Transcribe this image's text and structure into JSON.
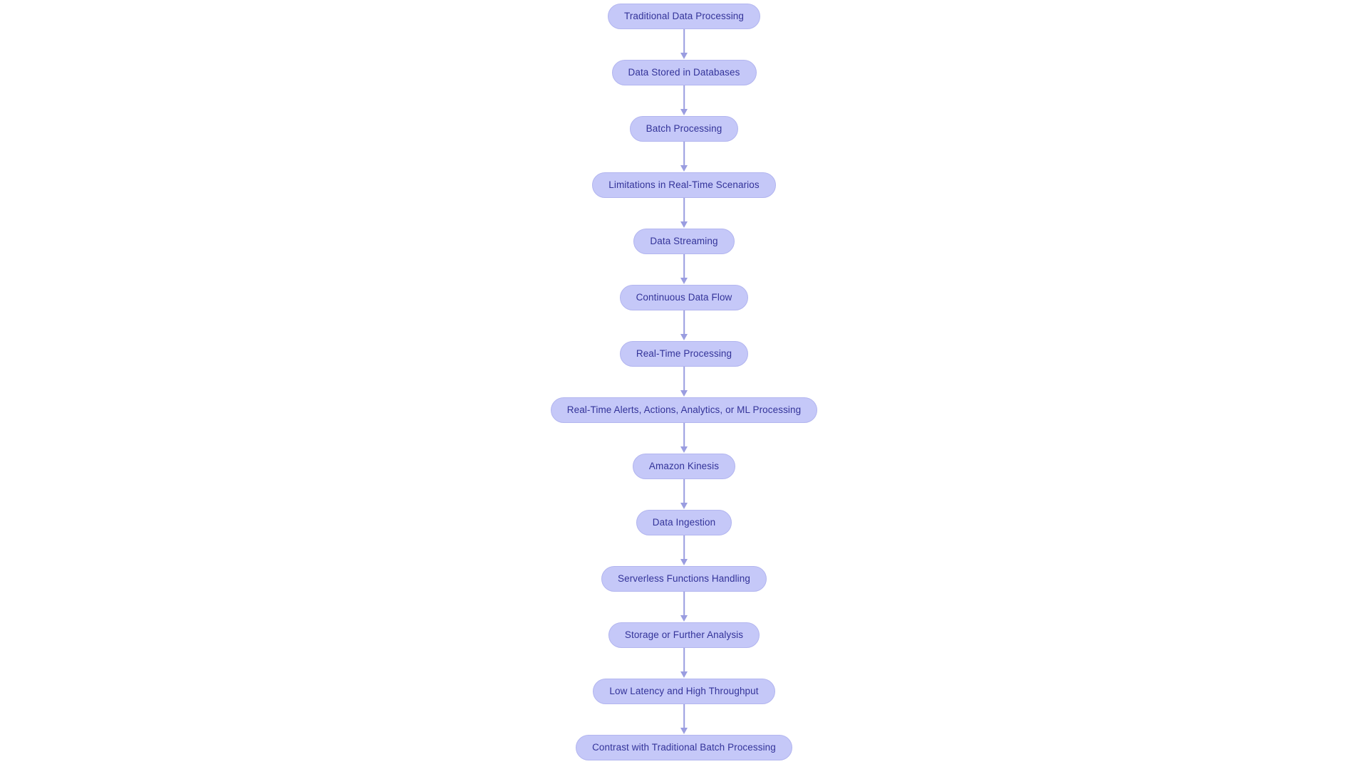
{
  "diagram": {
    "type": "flowchart",
    "orientation": "top-to-bottom",
    "title": "",
    "background_color": "#ffffff",
    "node_fill_color": "#c5c8f8",
    "node_border_color": "#b2b5ef",
    "node_text_color": "#333399",
    "connector_color": "#9a9de0",
    "nodes": [
      {
        "id": "n1",
        "label": "Traditional Data Processing"
      },
      {
        "id": "n2",
        "label": "Data Stored in Databases"
      },
      {
        "id": "n3",
        "label": "Batch Processing"
      },
      {
        "id": "n4",
        "label": "Limitations in Real-Time Scenarios"
      },
      {
        "id": "n5",
        "label": "Data Streaming"
      },
      {
        "id": "n6",
        "label": "Continuous Data Flow"
      },
      {
        "id": "n7",
        "label": "Real-Time Processing"
      },
      {
        "id": "n8",
        "label": "Real-Time Alerts, Actions, Analytics, or ML Processing"
      },
      {
        "id": "n9",
        "label": "Amazon Kinesis"
      },
      {
        "id": "n10",
        "label": "Data Ingestion"
      },
      {
        "id": "n11",
        "label": "Serverless Functions Handling"
      },
      {
        "id": "n12",
        "label": "Storage or Further Analysis"
      },
      {
        "id": "n13",
        "label": "Low Latency and High Throughput"
      },
      {
        "id": "n14",
        "label": "Contrast with Traditional Batch Processing"
      }
    ],
    "edges": [
      {
        "from": "n1",
        "to": "n2",
        "label": "",
        "arrow": "down-arrow"
      },
      {
        "from": "n2",
        "to": "n3",
        "label": "",
        "arrow": "down-arrow"
      },
      {
        "from": "n3",
        "to": "n4",
        "label": "",
        "arrow": "down-arrow"
      },
      {
        "from": "n4",
        "to": "n5",
        "label": "",
        "arrow": "down-arrow"
      },
      {
        "from": "n5",
        "to": "n6",
        "label": "",
        "arrow": "down-arrow"
      },
      {
        "from": "n6",
        "to": "n7",
        "label": "",
        "arrow": "down-arrow"
      },
      {
        "from": "n7",
        "to": "n8",
        "label": "",
        "arrow": "down-arrow"
      },
      {
        "from": "n8",
        "to": "n9",
        "label": "",
        "arrow": "down-arrow"
      },
      {
        "from": "n9",
        "to": "n10",
        "label": "",
        "arrow": "down-arrow"
      },
      {
        "from": "n10",
        "to": "n11",
        "label": "",
        "arrow": "down-arrow"
      },
      {
        "from": "n11",
        "to": "n12",
        "label": "",
        "arrow": "down-arrow"
      },
      {
        "from": "n12",
        "to": "n13",
        "label": "",
        "arrow": "down-arrow"
      },
      {
        "from": "n13",
        "to": "n14",
        "label": "",
        "arrow": "down-arrow"
      }
    ]
  }
}
